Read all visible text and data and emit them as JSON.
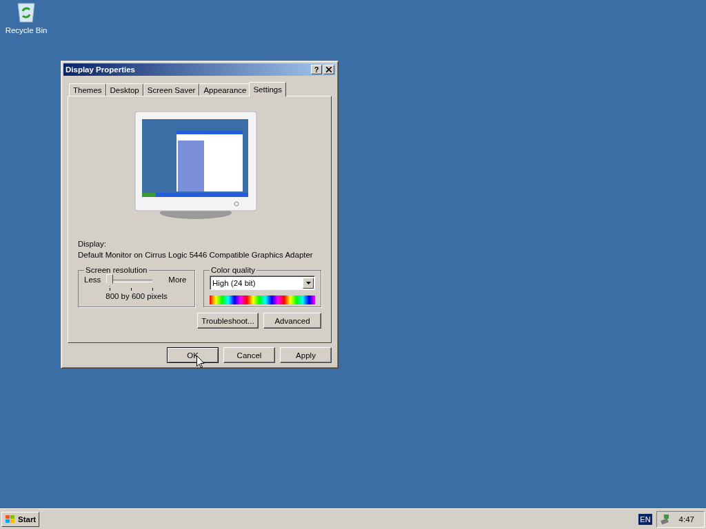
{
  "desktop_icons": [
    {
      "label": "Recycle Bin"
    }
  ],
  "window": {
    "title": "Display Properties",
    "help_button": "?"
  },
  "tabs": [
    {
      "label": "Themes",
      "selected": false
    },
    {
      "label": "Desktop",
      "selected": false
    },
    {
      "label": "Screen Saver",
      "selected": false
    },
    {
      "label": "Appearance",
      "selected": false
    },
    {
      "label": "Settings",
      "selected": true
    }
  ],
  "display": {
    "label": "Display:",
    "value": "Default Monitor on Cirrus Logic 5446 Compatible Graphics Adapter"
  },
  "screen_resolution": {
    "title": "Screen resolution",
    "min_label": "Less",
    "max_label": "More",
    "level": 0,
    "reading": "800 by 600 pixels"
  },
  "color_quality": {
    "title": "Color quality",
    "value": "High (24 bit)"
  },
  "panel_buttons": [
    {
      "label": "Troubleshoot...",
      "default": false
    },
    {
      "label": "Advanced",
      "default": false
    }
  ],
  "dialog_buttons": [
    {
      "label": "OK",
      "default": true
    },
    {
      "label": "Cancel",
      "default": false
    },
    {
      "label": "Apply",
      "default": false
    }
  ],
  "taskbar": {
    "start": "Start",
    "language": "EN",
    "clock": "4:47"
  }
}
